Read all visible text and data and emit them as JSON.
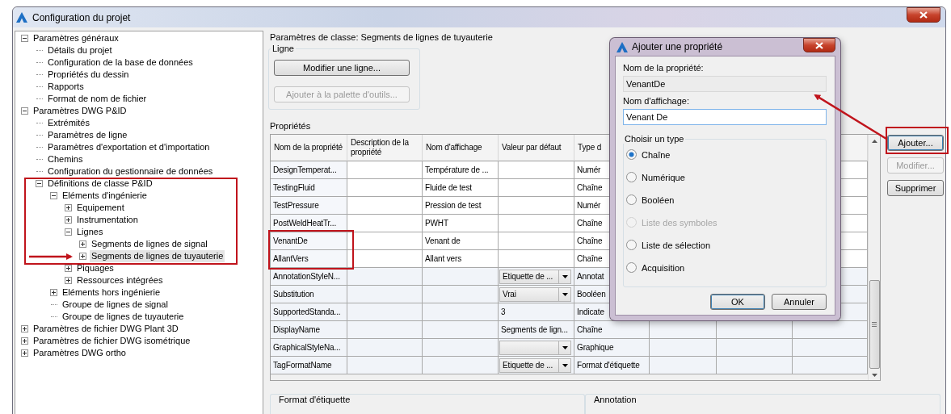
{
  "window": {
    "title": "Configuration du projet"
  },
  "tree": [
    {
      "label": "Paramètres généraux",
      "expanded": true,
      "selected": false,
      "children": [
        {
          "label": "Détails du projet",
          "selected": false
        },
        {
          "label": "Configuration de la base de données",
          "selected": false
        },
        {
          "label": "Propriétés du dessin",
          "selected": false
        },
        {
          "label": "Rapports",
          "selected": false
        },
        {
          "label": "Format de nom de fichier",
          "selected": false
        }
      ]
    },
    {
      "label": "Paramètres DWG P&ID",
      "expanded": true,
      "selected": false,
      "children": [
        {
          "label": "Extrémités",
          "selected": false
        },
        {
          "label": "Paramètres de ligne",
          "selected": false
        },
        {
          "label": "Paramètres d'exportation et d'importation",
          "selected": false
        },
        {
          "label": "Chemins",
          "selected": false
        },
        {
          "label": "Configuration du gestionnaire de données",
          "selected": false
        },
        {
          "label": "Définitions de classe P&ID",
          "expanded": true,
          "selected": false,
          "children": [
            {
              "label": "Eléments d'ingénierie",
              "expanded": true,
              "selected": false,
              "children": [
                {
                  "label": "Equipement",
                  "expanded": false,
                  "selected": false
                },
                {
                  "label": "Instrumentation",
                  "expanded": false,
                  "selected": false
                },
                {
                  "label": "Lignes",
                  "expanded": true,
                  "selected": false,
                  "children": [
                    {
                      "label": "Segments de lignes de signal",
                      "expanded": false,
                      "selected": false
                    },
                    {
                      "label": "Segments de lignes de tuyauterie",
                      "expanded": false,
                      "selected": true
                    }
                  ]
                },
                {
                  "label": "Piquages",
                  "expanded": false,
                  "selected": false
                },
                {
                  "label": "Ressources intégrées",
                  "expanded": false,
                  "selected": false
                }
              ]
            },
            {
              "label": "Eléments hors ingénierie",
              "expanded": false,
              "selected": false
            },
            {
              "label": "Groupe de lignes de signal",
              "selected": false
            },
            {
              "label": "Groupe de lignes de tuyauterie",
              "selected": false
            }
          ]
        }
      ]
    },
    {
      "label": "Paramètres de fichier DWG Plant 3D",
      "expanded": false,
      "selected": false
    },
    {
      "label": "Paramètres de fichier DWG isométrique",
      "expanded": false,
      "selected": false
    },
    {
      "label": "Paramètres DWG ortho",
      "expanded": false,
      "selected": false
    }
  ],
  "class_settings": {
    "title": "Paramètres de classe: Segments de lignes de tuyauterie",
    "line_group": {
      "title": "Ligne",
      "buttons": [
        {
          "label": "Modifier une ligne...",
          "disabled": false
        },
        {
          "label": "Ajouter à la palette d'outils...",
          "disabled": true
        }
      ]
    },
    "properties": {
      "title": "Propriétés",
      "columns": [
        "Nom de la propriété",
        "Description de la propriété",
        "Nom d'affichage",
        "Valeur par défaut",
        "Type d"
      ],
      "rows": [
        {
          "name": "DesignTemperat...",
          "display": "Température de ...",
          "type": "Numér",
          "readonly": false
        },
        {
          "name": "TestingFluid",
          "display": "Fluide de test",
          "type": "Chaîne",
          "readonly": false
        },
        {
          "name": "TestPressure",
          "display": "Pression de test",
          "type": "Numér",
          "readonly": false
        },
        {
          "name": "PostWeldHeatTr...",
          "display": "PWHT",
          "type": "Chaîne",
          "readonly": false
        },
        {
          "name": "VenantDe",
          "display": "Venant de",
          "type": "Chaîne",
          "readonly": false
        },
        {
          "name": "AllantVers",
          "display": "Allant vers",
          "type": "Chaîne",
          "readonly": false
        },
        {
          "name": "AnnotationStyleN...",
          "default": {
            "kind": "dropdown",
            "value": "Etiquette de ..."
          },
          "type": "Annotat",
          "readonly": true
        },
        {
          "name": "Substitution",
          "default": {
            "kind": "dropdown",
            "value": "Vrai"
          },
          "type": "Booléen",
          "readonly": true
        },
        {
          "name": "SupportedStanda...",
          "default": {
            "kind": "text",
            "value": "3"
          },
          "type": "Indicate",
          "readonly": true
        },
        {
          "name": "DisplayName",
          "default": {
            "kind": "text",
            "value": "Segments de lign..."
          },
          "type": "Chaîne",
          "readonly": true
        },
        {
          "name": "GraphicalStyleNa...",
          "default": {
            "kind": "dropdown"
          },
          "type": "Graphique",
          "readonly": true
        },
        {
          "name": "TagFormatName",
          "default": {
            "kind": "dropdown",
            "value": "Etiquette de ..."
          },
          "type": "Format d'étiquette",
          "readonly": true
        }
      ],
      "buttons": [
        {
          "label": "Ajouter...",
          "disabled": false
        },
        {
          "label": "Modifier...",
          "disabled": true
        },
        {
          "label": "Supprimer",
          "disabled": false
        }
      ]
    },
    "bottom_groups": [
      "Format d'étiquette",
      "Annotation"
    ]
  },
  "dialog": {
    "title": "Ajouter une propriété",
    "name_label": "Nom de la propriété:",
    "name_value": "VenantDe",
    "display_label": "Nom d'affichage:",
    "display_value": "Venant De",
    "type_group": "Choisir un type",
    "types": [
      {
        "label": "Chaîne",
        "selected": true,
        "disabled": false
      },
      {
        "label": "Numérique",
        "selected": false,
        "disabled": false
      },
      {
        "label": "Booléen",
        "selected": false,
        "disabled": false
      },
      {
        "label": "Liste des symboles",
        "selected": false,
        "disabled": true
      },
      {
        "label": "Liste de sélection",
        "selected": false,
        "disabled": false
      },
      {
        "label": "Acquisition",
        "selected": false,
        "disabled": false
      }
    ],
    "buttons": [
      "OK",
      "Annuler"
    ]
  }
}
